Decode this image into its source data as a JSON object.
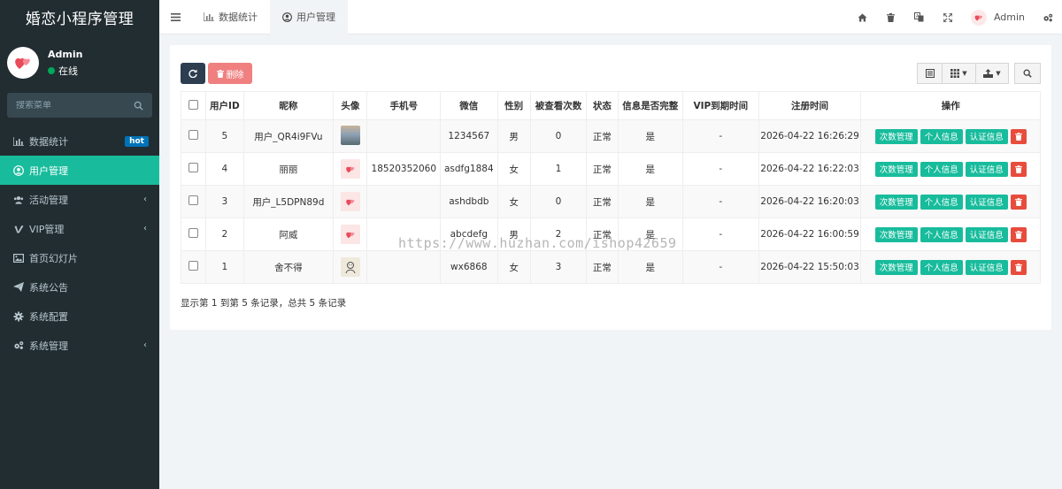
{
  "app": {
    "title": "婚恋小程序管理"
  },
  "sidebar": {
    "user": {
      "name": "Admin",
      "status": "在线"
    },
    "search_placeholder": "搜索菜单",
    "items": [
      {
        "label": "数据统计",
        "icon": "bar-chart-icon",
        "badge": "hot"
      },
      {
        "label": "用户管理",
        "icon": "user-circle-icon",
        "active": true
      },
      {
        "label": "活动管理",
        "icon": "users-icon",
        "has_children": true
      },
      {
        "label": "VIP管理",
        "icon": "vimeo-v-icon",
        "has_children": true
      },
      {
        "label": "首页幻灯片",
        "icon": "image-icon"
      },
      {
        "label": "系统公告",
        "icon": "paper-plane-icon"
      },
      {
        "label": "系统配置",
        "icon": "cog-icon"
      },
      {
        "label": "系统管理",
        "icon": "cogs-icon",
        "has_children": true
      }
    ]
  },
  "header": {
    "tabs": [
      {
        "label": "数据统计",
        "icon": "bar-chart-icon"
      },
      {
        "label": "用户管理",
        "icon": "user-circle-icon",
        "active": true
      }
    ],
    "admin_name": "Admin"
  },
  "toolbar": {
    "delete_label": "删除"
  },
  "table": {
    "columns": [
      "用户ID",
      "昵称",
      "头像",
      "手机号",
      "微信",
      "性别",
      "被查看次数",
      "状态",
      "信息是否完整",
      "VIP到期时间",
      "注册时间",
      "操作"
    ],
    "rows": [
      {
        "id": "5",
        "nickname": "用户_QR4i9FVu",
        "avatar": "landscape",
        "phone": "",
        "wechat": "1234567",
        "gender": "男",
        "views": "0",
        "status": "正常",
        "complete": "是",
        "vip_expire": "-",
        "registered": "2026-04-22 16:26:29"
      },
      {
        "id": "4",
        "nickname": "丽丽",
        "avatar": "heart",
        "phone": "18520352060",
        "wechat": "asdfg1884",
        "gender": "女",
        "views": "1",
        "status": "正常",
        "complete": "是",
        "vip_expire": "-",
        "registered": "2026-04-22 16:22:03"
      },
      {
        "id": "3",
        "nickname": "用户_L5DPN89d",
        "avatar": "heart",
        "phone": "",
        "wechat": "ashdbdb",
        "gender": "女",
        "views": "0",
        "status": "正常",
        "complete": "是",
        "vip_expire": "-",
        "registered": "2026-04-22 16:20:03"
      },
      {
        "id": "2",
        "nickname": "阿威",
        "avatar": "heart",
        "phone": "",
        "wechat": "abcdefg",
        "gender": "男",
        "views": "2",
        "status": "正常",
        "complete": "是",
        "vip_expire": "-",
        "registered": "2026-04-22 16:00:59"
      },
      {
        "id": "1",
        "nickname": "舍不得",
        "avatar": "sketch",
        "phone": "",
        "wechat": "wx6868",
        "gender": "女",
        "views": "3",
        "status": "正常",
        "complete": "是",
        "vip_expire": "-",
        "registered": "2026-04-22 15:50:03"
      }
    ],
    "row_actions": [
      "次数管理",
      "个人信息",
      "认证信息"
    ]
  },
  "pagination": {
    "summary": "显示第 1 到第 5 条记录，总共 5 条记录"
  },
  "watermark": "https://www.huzhan.com/ishop42659",
  "colors": {
    "sidebar_bg": "#222d32",
    "accent": "#18bc9c",
    "danger": "#e74c3c",
    "hot_badge": "#0073b7"
  }
}
